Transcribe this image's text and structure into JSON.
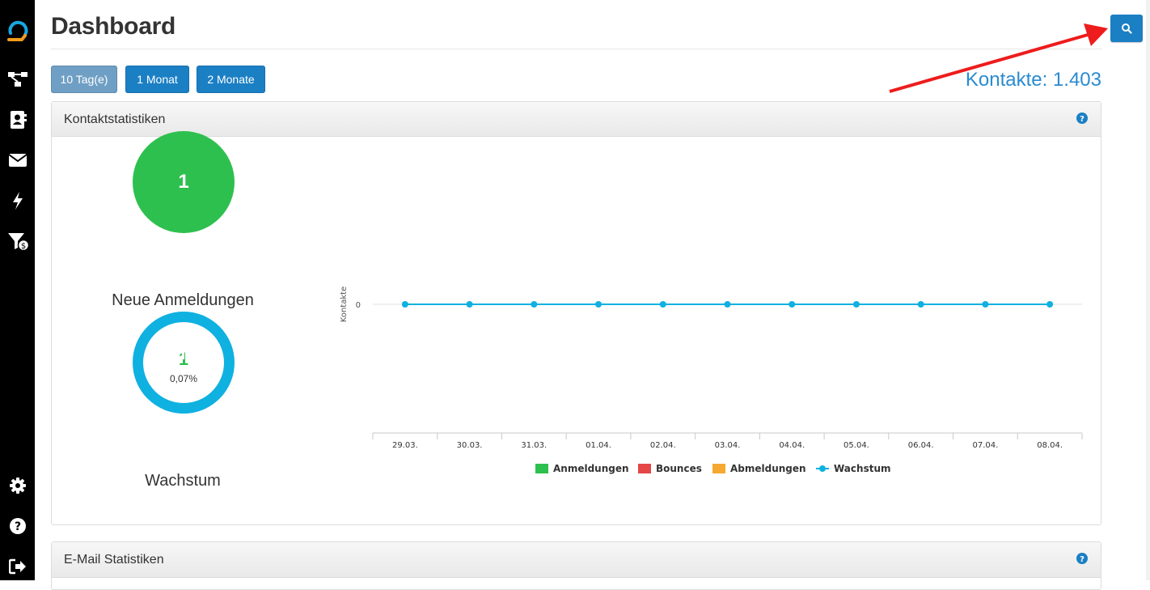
{
  "page": {
    "title": "Dashboard"
  },
  "ranges": [
    {
      "label": "10 Tag(e)",
      "active": true
    },
    {
      "label": "1 Monat",
      "active": false
    },
    {
      "label": "2 Monate",
      "active": false
    }
  ],
  "kontakte_total": "Kontakte: 1.403",
  "panels": {
    "kontakt": {
      "title": "Kontaktstatistiken"
    },
    "email": {
      "title": "E-Mail Statistiken"
    }
  },
  "stats": {
    "neue": {
      "value": "1",
      "label": "Neue Anmeldungen"
    },
    "wachstum": {
      "value": "1",
      "percent": "0,07%",
      "label": "Wachstum"
    }
  },
  "sidebar": {
    "icons": [
      "logo-icon",
      "flow-icon",
      "contacts-icon",
      "mail-icon",
      "bolt-icon",
      "funnel-dollar-icon",
      "gear-icon",
      "help-icon",
      "logout-icon"
    ]
  },
  "colors": {
    "primary": "#1b7fc4",
    "active_range": "#6f9fc4",
    "green": "#2ec04f",
    "red": "#e54646",
    "orange": "#f6a830",
    "cyan": "#0fb1e0",
    "annotation_arrow": "#ee1c1c"
  },
  "chart_data": {
    "type": "line",
    "ylabel": "Kontakte",
    "yticks": [
      0
    ],
    "categories": [
      "29.03.",
      "30.03.",
      "31.03.",
      "01.04.",
      "02.04.",
      "03.04.",
      "04.04.",
      "05.04.",
      "06.04.",
      "07.04.",
      "08.04."
    ],
    "series": [
      {
        "name": "Anmeldungen",
        "kind": "bar",
        "color": "#2ec04f",
        "values": [
          0,
          0,
          0,
          0,
          0,
          0,
          0,
          0,
          0,
          0,
          0
        ]
      },
      {
        "name": "Bounces",
        "kind": "bar",
        "color": "#e54646",
        "values": [
          0,
          0,
          0,
          0,
          0,
          0,
          0,
          0,
          0,
          0,
          0
        ]
      },
      {
        "name": "Abmeldungen",
        "kind": "bar",
        "color": "#f6a830",
        "values": [
          0,
          0,
          0,
          0,
          0,
          0,
          0,
          0,
          0,
          0,
          0
        ]
      },
      {
        "name": "Wachstum",
        "kind": "line",
        "color": "#0fb1e0",
        "values": [
          0,
          0,
          0,
          0,
          0,
          0,
          0,
          0,
          0,
          0,
          0
        ]
      }
    ],
    "legend_position": "bottom",
    "grid": true
  }
}
